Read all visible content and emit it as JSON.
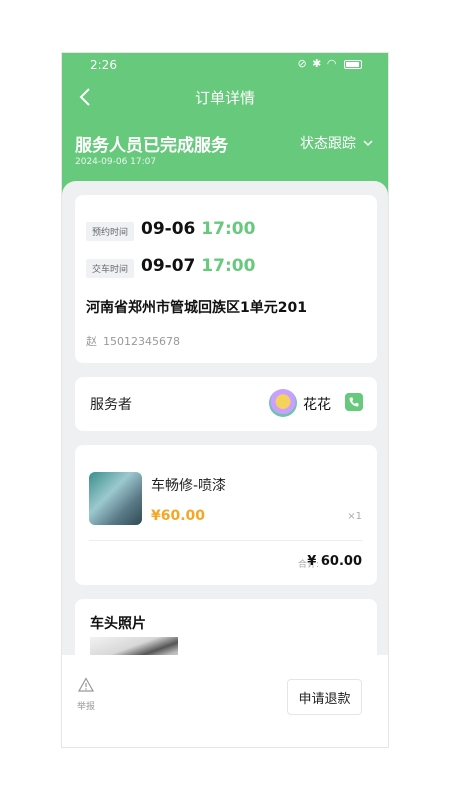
{
  "status_bar": {
    "time": "2:26"
  },
  "navbar": {
    "title": "订单详情"
  },
  "order_status": {
    "title": "服务人员已完成服务",
    "time": "2024-09-06 17:07",
    "tracking_label": "状态跟踪"
  },
  "appointment": {
    "booking_tag": "预约时间",
    "booking_date": "09-06",
    "booking_time": "17:00",
    "delivery_tag": "交车时间",
    "delivery_date": "09-07",
    "delivery_time": "17:00",
    "address": "河南省郑州市管城回族区1单元201",
    "contact_name": "赵",
    "contact_phone": "15012345678"
  },
  "provider": {
    "label": "服务者",
    "name": "花花"
  },
  "product": {
    "name": "车畅修-喷漆",
    "price": "¥60.00",
    "qty": "×1",
    "total_label": "合计:",
    "total_value": "¥ 60.00"
  },
  "photos": {
    "title": "车头照片"
  },
  "bottom": {
    "report_label": "举报",
    "refund_label": "申请退款"
  },
  "colors": {
    "primary": "#67c97c",
    "price": "#f5a623"
  }
}
